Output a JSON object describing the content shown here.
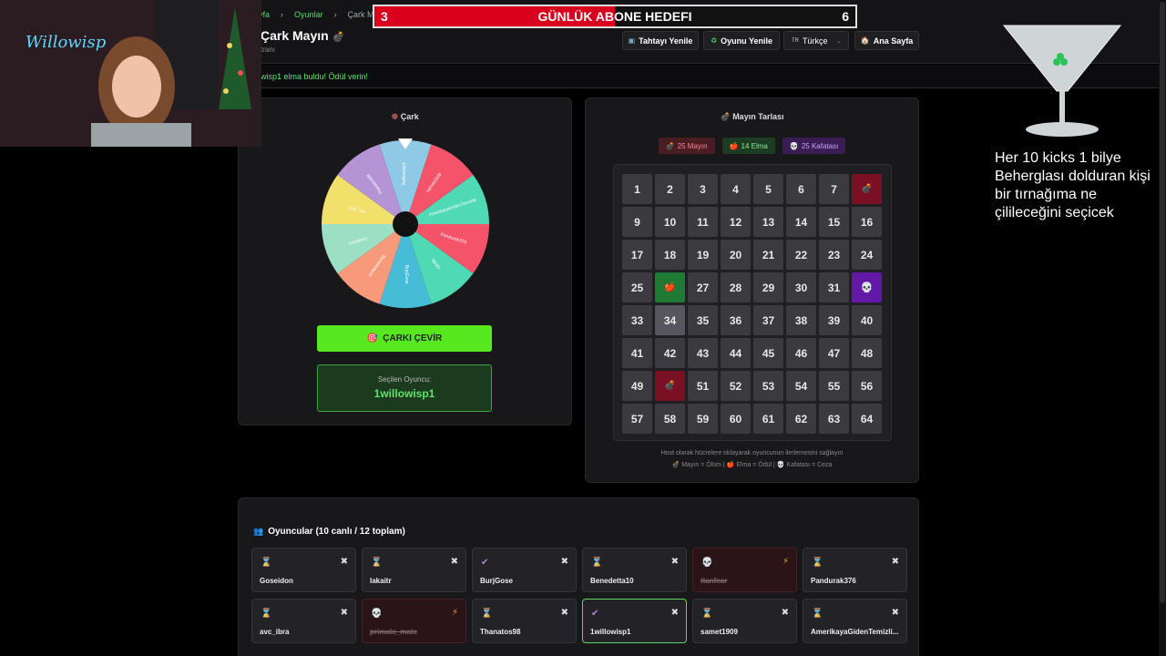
{
  "breadcrumb": {
    "home": "yfa",
    "games": "Oyunlar",
    "current": "Çark Mayın"
  },
  "page": {
    "title": "Çark Mayın",
    "title_icon": "💣",
    "subtitle": "tranı"
  },
  "header_buttons": [
    {
      "icon": "▣",
      "label": "Tahtayı Yenile"
    },
    {
      "icon": "♻",
      "label": "Oyunu Yenile"
    },
    {
      "icon": "TR",
      "label": "Türkçe"
    },
    {
      "icon": "🏠",
      "label": "Ana Sayfa"
    }
  ],
  "notice": "wisp1 elma buldu! Ödül verin!",
  "goal": {
    "title": "GÜNLÜK ABONE HEDEFI",
    "current": "3",
    "target": "6",
    "progress": 0.5,
    "color": "#d9001e"
  },
  "wheel_panel": {
    "title": "Çark",
    "title_icon": "☸",
    "segments": [
      {
        "label": "1willowisp1",
        "color": "#8ec9e6"
      },
      {
        "label": "samet1909",
        "color": "#f5536a"
      },
      {
        "label": "AmerikayaGidenTemizlik",
        "color": "#4fd9b4"
      },
      {
        "label": "Pandurak376",
        "color": "#f5536a"
      },
      {
        "label": "lakaitr",
        "color": "#4fd9b4"
      },
      {
        "label": "BurjGose",
        "color": "#46bcd6"
      },
      {
        "label": "Benedetta10",
        "color": "#f79a7a"
      },
      {
        "label": "Goseidon",
        "color": "#9be0c4"
      },
      {
        "label": "avc_ibra",
        "color": "#f1e06a"
      },
      {
        "label": "Thanatos98",
        "color": "#b594d6"
      }
    ],
    "spin_icon": "🎯",
    "spin_label": "ÇARKI ÇEVİR",
    "selected_label": "Seçilen Oyuncu:",
    "selected_value": "1willowisp1"
  },
  "board_panel": {
    "title": "Mayın Tarlası",
    "title_icon": "💣",
    "badges": {
      "mines": "25 Mayın",
      "apples": "14 Elma",
      "skulls": "25 Kafatası"
    },
    "cells": [
      "1",
      "2",
      "3",
      "4",
      "5",
      "6",
      "7",
      "💣",
      "9",
      "10",
      "11",
      "12",
      "13",
      "14",
      "15",
      "16",
      "17",
      "18",
      "19",
      "20",
      "21",
      "22",
      "23",
      "24",
      "25",
      "🍎",
      "27",
      "28",
      "29",
      "30",
      "31",
      "💀",
      "33",
      "34",
      "35",
      "36",
      "37",
      "38",
      "39",
      "40",
      "41",
      "42",
      "43",
      "44",
      "45",
      "46",
      "47",
      "48",
      "49",
      "💣",
      "51",
      "52",
      "53",
      "54",
      "55",
      "56",
      "57",
      "58",
      "59",
      "60",
      "61",
      "62",
      "63",
      "64"
    ],
    "cell_types": {
      "7": "mine",
      "25": "apple",
      "31": "skull",
      "33": "hov",
      "49": "mine"
    },
    "footer_line1": "Host olarak hücrelere tıklayarak oyuncunun ilerlemesini sağlayın",
    "footer_line2": "💣 Mayın = Ölüm | 🍎 Elma = Ödül | 💀 Kafatası = Ceza"
  },
  "players": {
    "title": "Oyuncular (10 canlı / 12 toplam)",
    "title_icon": "👥",
    "list": [
      {
        "name": "Goseidon",
        "status": "⌛",
        "state": "waiting"
      },
      {
        "name": "lakaitr",
        "status": "⌛",
        "state": "waiting"
      },
      {
        "name": "BurjGose",
        "status": "✔",
        "state": "done"
      },
      {
        "name": "Benedetta10",
        "status": "⌛",
        "state": "waiting"
      },
      {
        "name": "ttanfear",
        "status": "💀",
        "state": "dead"
      },
      {
        "name": "Pandurak376",
        "status": "⌛",
        "state": "waiting"
      },
      {
        "name": "avc_ibra",
        "status": "⌛",
        "state": "waiting"
      },
      {
        "name": "primate_mate",
        "status": "💀",
        "state": "dead"
      },
      {
        "name": "Thanatos98",
        "status": "⌛",
        "state": "waiting"
      },
      {
        "name": "1willowisp1",
        "status": "✔",
        "state": "selected"
      },
      {
        "name": "samet1909",
        "status": "⌛",
        "state": "waiting"
      },
      {
        "name": "AmerikayaGidenTemizli...",
        "status": "⌛",
        "state": "waiting"
      }
    ]
  },
  "overlay": {
    "cam_sign": "Willowisp",
    "note": "Her 10 kicks 1 bilye Beherglası dolduran kişi bir tırnağıma ne çilileceğini seçicek"
  }
}
